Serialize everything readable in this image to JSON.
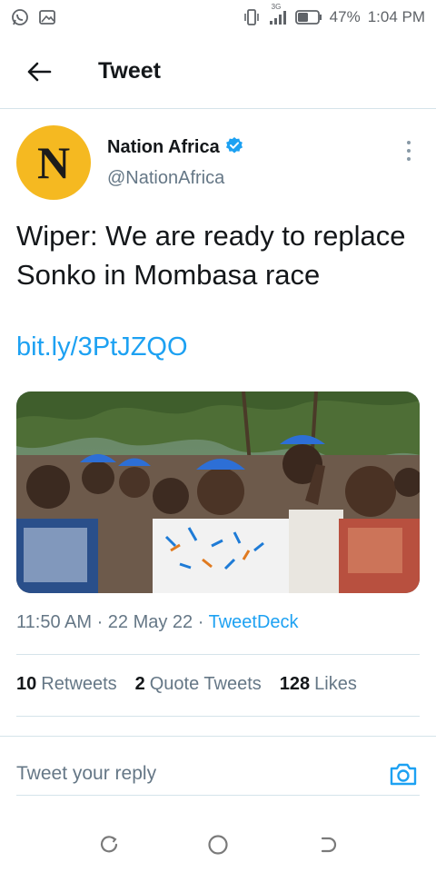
{
  "status_bar": {
    "left_icons": [
      "whatsapp-icon",
      "image-icon"
    ],
    "network_label": "3G",
    "battery": "47%",
    "time": "1:04 PM"
  },
  "header": {
    "title": "Tweet"
  },
  "tweet": {
    "author": {
      "avatar_letter": "N",
      "name": "Nation Africa",
      "handle": "@NationAfrica",
      "verified": true
    },
    "text": "Wiper: We are ready to replace Sonko in Mombasa race",
    "link": "bit.ly/3PtJZQO",
    "time": "11:50 AM · 22 May 22 · ",
    "source": "TweetDeck"
  },
  "stats": {
    "retweets_count": "10",
    "retweets_label": "Retweets",
    "quotes_count": "2",
    "quotes_label": "Quote Tweets",
    "likes_count": "128",
    "likes_label": "Likes"
  },
  "reply": {
    "placeholder": "Tweet your reply"
  },
  "colors": {
    "accent": "#1da1f2",
    "avatar_bg": "#f5b921",
    "divider": "#d5e4ea",
    "muted_text": "#657786"
  }
}
